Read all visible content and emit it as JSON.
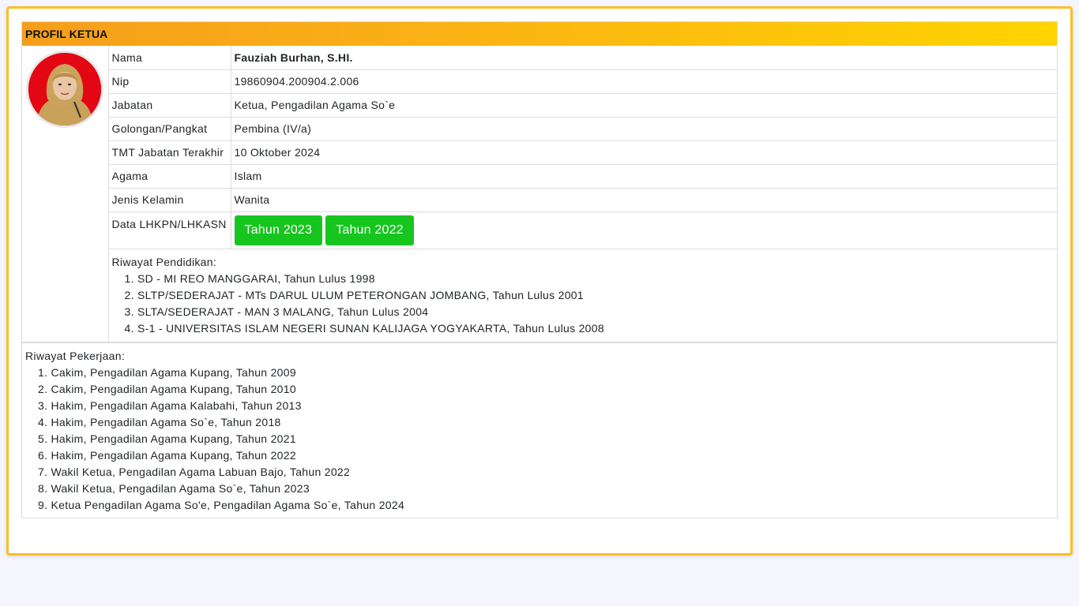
{
  "header": {
    "title": "PROFIL KETUA"
  },
  "profile": {
    "rows": [
      {
        "label": "Nama",
        "value": "Fauziah Burhan, S.HI."
      },
      {
        "label": "Nip",
        "value": "19860904.200904.2.006"
      },
      {
        "label": "Jabatan",
        "value": "Ketua, Pengadilan Agama So`e"
      },
      {
        "label": "Golongan/Pangkat",
        "value": "Pembina (IV/a)"
      },
      {
        "label": "TMT Jabatan Terakhir",
        "value": "10 Oktober 2024"
      },
      {
        "label": "Agama",
        "value": "Islam"
      },
      {
        "label": "Jenis Kelamin",
        "value": "Wanita"
      }
    ],
    "lhkpn": {
      "label": "Data LHKPN/LHKASN",
      "buttons": [
        "Tahun 2023",
        "Tahun 2022"
      ]
    }
  },
  "education": {
    "title": "Riwayat Pendidikan:",
    "items": [
      "1. SD - MI REO MANGGARAI, Tahun Lulus 1998",
      "2. SLTP/SEDERAJAT - MTs DARUL ULUM PETERONGAN JOMBANG, Tahun Lulus 2001",
      "3. SLTA/SEDERAJAT - MAN 3 MALANG, Tahun Lulus 2004",
      "4. S-1 - UNIVERSITAS ISLAM NEGERI SUNAN KALIJAGA YOGYAKARTA, Tahun Lulus 2008"
    ]
  },
  "work": {
    "title": "Riwayat Pekerjaan:",
    "items": [
      "1. Cakim, Pengadilan Agama Kupang, Tahun 2009",
      "2. Cakim, Pengadilan Agama Kupang, Tahun 2010",
      "3. Hakim, Pengadilan Agama Kalabahi, Tahun 2013",
      "4. Hakim, Pengadilan Agama So`e, Tahun 2018",
      "5. Hakim, Pengadilan Agama Kupang, Tahun 2021",
      "6. Hakim, Pengadilan Agama Kupang, Tahun 2022",
      "7. Wakil Ketua, Pengadilan Agama Labuan Bajo, Tahun 2022",
      "8. Wakil Ketua, Pengadilan Agama So`e, Tahun 2023",
      "9. Ketua Pengadilan Agama So'e, Pengadilan Agama So`e, Tahun 2024"
    ]
  },
  "colors": {
    "accent": "#fbbf24",
    "button": "#17c51f",
    "photo_bg": "#e30613"
  }
}
